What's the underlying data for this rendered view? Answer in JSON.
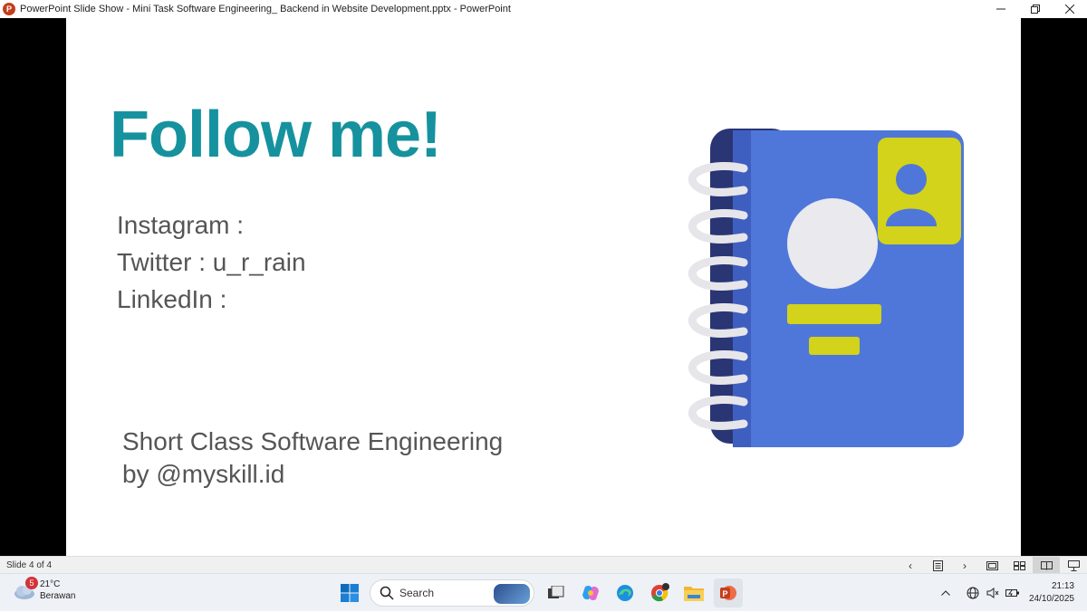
{
  "window": {
    "title": "PowerPoint Slide Show  -  Mini Task Software Engineering_ Backend in Website Development.pptx - PowerPoint",
    "app_icon_letter": "P"
  },
  "slide": {
    "title": "Follow me!",
    "social": {
      "instagram": "Instagram :",
      "twitter": "Twitter : u_r_rain",
      "linkedin": "LinkedIn :"
    },
    "footer": {
      "line1": "Short Class Software Engineering",
      "line2": "by @myskill.id"
    },
    "colors": {
      "title": "#16929e",
      "body_text": "#555555",
      "notebook_blue": "#4f77d9",
      "notebook_spine": "#2a3574",
      "notebook_yellow": "#d2d31a"
    },
    "illustration_icon": "contact-book-icon"
  },
  "statusbar": {
    "slide_count": "Slide 4 of 4",
    "active_view": "reading-view"
  },
  "taskbar": {
    "weather": {
      "badge": "5",
      "temp": "21°C",
      "condition": "Berawan"
    },
    "search": {
      "label": "Search"
    },
    "time": "21:13",
    "date": "24/10/2025",
    "pinned_icons": [
      "windows-start-icon",
      "task-view-icon",
      "copilot-icon",
      "edge-icon",
      "chrome-icon",
      "file-explorer-icon",
      "powerpoint-icon"
    ]
  }
}
